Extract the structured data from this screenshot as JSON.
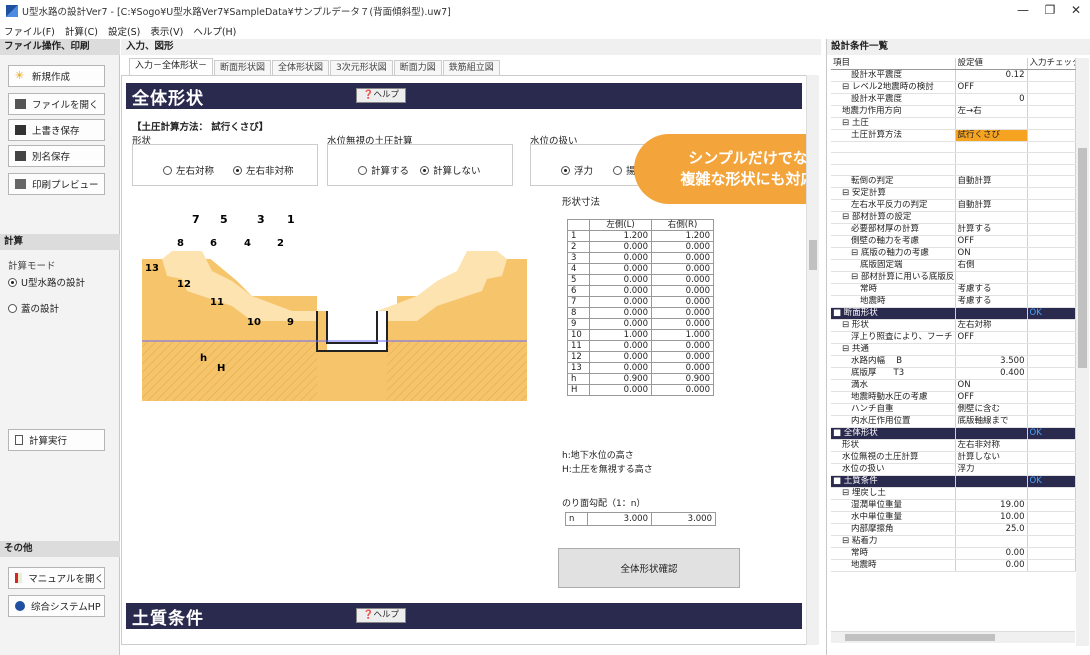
{
  "window": {
    "title": "U型水路の設計Ver7 - [C:¥Sogo¥U型水路Ver7¥SampleData¥サンプルデータ７(背面傾斜型).uw7]",
    "minimize": "—",
    "maximize": "❐",
    "close": "✕"
  },
  "menu": [
    "ファイル(F)",
    "計算(C)",
    "設定(S)",
    "表示(V)",
    "ヘルプ(H)"
  ],
  "left": {
    "file_header": "ファイル操作、印刷",
    "file_buttons": [
      "新規作成",
      "ファイルを開く",
      "上書き保存",
      "別名保存",
      "印刷プレビュー"
    ],
    "calc_header": "計算",
    "calc_mode_label": "計算モード",
    "calc_modes": [
      "U型水路の設計",
      "蓋の設計"
    ],
    "calc_button": "計算実行",
    "other_header": "その他",
    "other_buttons": [
      "マニュアルを開く",
      "综合システムHP"
    ]
  },
  "center": {
    "header": "入力、図形",
    "tabs": [
      "入力－全体形状－",
      "断面形状図",
      "全体形状図",
      "3次元形状図",
      "断面力図",
      "鉄筋組立図"
    ],
    "banner_title": "全体形状",
    "help_label": "ヘルプ",
    "method_label": "【土圧計算方法： 試行くさび】",
    "shape_label": "形状",
    "shape_opts": [
      "左右対称",
      "左右非対称"
    ],
    "wl_label": "水位無視の土圧計算",
    "wl_opts": [
      "計算する",
      "計算しない"
    ],
    "water_label": "水位の扱い",
    "water_opts": [
      "浮力",
      "揚圧"
    ],
    "dim_label": "形状寸法",
    "dim_table": {
      "headers": [
        "",
        "左側(L)",
        "右側(R)"
      ],
      "rows": [
        [
          "1",
          "1.200",
          "1.200"
        ],
        [
          "2",
          "0.000",
          "0.000"
        ],
        [
          "3",
          "0.000",
          "0.000"
        ],
        [
          "4",
          "0.000",
          "0.000"
        ],
        [
          "5",
          "0.000",
          "0.000"
        ],
        [
          "6",
          "0.000",
          "0.000"
        ],
        [
          "7",
          "0.000",
          "0.000"
        ],
        [
          "8",
          "0.000",
          "0.000"
        ],
        [
          "9",
          "0.000",
          "0.000"
        ],
        [
          "10",
          "1.000",
          "1.000"
        ],
        [
          "11",
          "0.000",
          "0.000"
        ],
        [
          "12",
          "0.000",
          "0.000"
        ],
        [
          "13",
          "0.000",
          "0.000"
        ],
        [
          "h",
          "0.900",
          "0.900"
        ],
        [
          "H",
          "0.000",
          "0.000"
        ]
      ]
    },
    "note1": "h:地下水位の高さ",
    "note2": "H:土圧を無視する高さ",
    "slope_label": "のり面勾配（1：n）",
    "slope_row": [
      "n",
      "3.000",
      "3.000"
    ],
    "confirm_button": "全体形状確認",
    "soil_banner": "土質条件",
    "callout_line1": "シンプルだけでなく、",
    "callout_line2": "複雑な形状にも対応可能",
    "diagram_labels": [
      "7",
      "5",
      "3",
      "1",
      "8",
      "6",
      "4",
      "2",
      "13",
      "12",
      "11",
      "10",
      "9",
      "h",
      "H"
    ]
  },
  "right": {
    "header": "設計条件一覧",
    "col_headers": [
      "項目",
      "設定値",
      "入力チェック"
    ],
    "rows": [
      {
        "t": "item",
        "l": "設計水平震度",
        "v": "0.12",
        "n": true,
        "i": 2
      },
      {
        "t": "item",
        "l": "⊟ レベル2地震時の検討",
        "v": "OFF",
        "i": 1
      },
      {
        "t": "item",
        "l": "設計水平震度",
        "v": "0",
        "n": true,
        "i": 2
      },
      {
        "t": "item",
        "l": "地震力作用方向",
        "v": "左→右",
        "i": 1
      },
      {
        "t": "item",
        "l": "⊟ 土圧",
        "v": "",
        "i": 1
      },
      {
        "t": "hl",
        "l": "土圧計算方法",
        "v": "試行くさび",
        "i": 2
      },
      {
        "t": "item",
        "l": "",
        "v": "",
        "i": 2
      },
      {
        "t": "item",
        "l": "",
        "v": "",
        "i": 2
      },
      {
        "t": "item",
        "l": "",
        "v": "",
        "i": 2
      },
      {
        "t": "item",
        "l": "転倒の判定",
        "v": "自動計算",
        "i": 2
      },
      {
        "t": "item",
        "l": "⊟ 安定計算",
        "v": "",
        "i": 1
      },
      {
        "t": "item",
        "l": "左右水平反力の判定",
        "v": "自動計算",
        "i": 2
      },
      {
        "t": "item",
        "l": "⊟ 部材計算の設定",
        "v": "",
        "i": 1
      },
      {
        "t": "item",
        "l": "必要部材厚の計算",
        "v": "計算する",
        "i": 2
      },
      {
        "t": "item",
        "l": "側壁の軸力を考慮",
        "v": "OFF",
        "i": 2
      },
      {
        "t": "item",
        "l": "⊟ 底版の軸力の考慮",
        "v": "ON",
        "i": 2
      },
      {
        "t": "item",
        "l": "底版固定端",
        "v": "右側",
        "i": 3
      },
      {
        "t": "item",
        "l": "⊟ 部材計算に用いる底版反",
        "v": "",
        "i": 2
      },
      {
        "t": "item",
        "l": "常時",
        "v": "考慮する",
        "i": 3
      },
      {
        "t": "item",
        "l": "地震時",
        "v": "考慮する",
        "i": 3
      },
      {
        "t": "cat",
        "l": "■ 断面形状",
        "v": "",
        "c": "OK"
      },
      {
        "t": "item",
        "l": "⊟ 形状",
        "v": "左右対称",
        "i": 1
      },
      {
        "t": "item",
        "l": "浮上り照査により、フーチ",
        "v": "OFF",
        "i": 2
      },
      {
        "t": "item",
        "l": "⊟ 共通",
        "v": "",
        "i": 1
      },
      {
        "t": "item",
        "l": "水路内幅　 B",
        "v": "3.500",
        "n": true,
        "i": 2
      },
      {
        "t": "item",
        "l": "底版厚　　T3",
        "v": "0.400",
        "n": true,
        "i": 2
      },
      {
        "t": "item",
        "l": "満水",
        "v": "ON",
        "i": 2
      },
      {
        "t": "item",
        "l": "地震時動水圧の考慮",
        "v": "OFF",
        "i": 2
      },
      {
        "t": "item",
        "l": "ハンチ自重",
        "v": "側壁に含む",
        "i": 2
      },
      {
        "t": "item",
        "l": "内水圧作用位置",
        "v": "底版軸線まで",
        "i": 2
      },
      {
        "t": "cat",
        "l": "■ 全体形状",
        "v": "",
        "c": "OK"
      },
      {
        "t": "item",
        "l": "形状",
        "v": "左右非対称",
        "i": 1
      },
      {
        "t": "item",
        "l": "水位無視の土圧計算",
        "v": "計算しない",
        "i": 1
      },
      {
        "t": "item",
        "l": "水位の扱い",
        "v": "浮力",
        "i": 1
      },
      {
        "t": "cat",
        "l": "■ 土質条件",
        "v": "",
        "c": "OK"
      },
      {
        "t": "item",
        "l": "⊟ 埋戻し土",
        "v": "",
        "i": 1
      },
      {
        "t": "item",
        "l": "湿潤単位重量",
        "v": "19.00",
        "n": true,
        "i": 2
      },
      {
        "t": "item",
        "l": "水中単位重量",
        "v": "10.00",
        "n": true,
        "i": 2
      },
      {
        "t": "item",
        "l": "内部摩擦角",
        "v": "25.0",
        "n": true,
        "i": 2
      },
      {
        "t": "item",
        "l": "⊟ 粘着力",
        "v": "",
        "i": 1
      },
      {
        "t": "item",
        "l": "常時",
        "v": "0.00",
        "n": true,
        "i": 2
      },
      {
        "t": "item",
        "l": "地震時",
        "v": "0.00",
        "n": true,
        "i": 2
      }
    ]
  },
  "colors": {
    "banner": "#2a2a4e",
    "callout": "#f3a43b",
    "soil": "#f6c46a",
    "highlight": "#f6a321"
  }
}
